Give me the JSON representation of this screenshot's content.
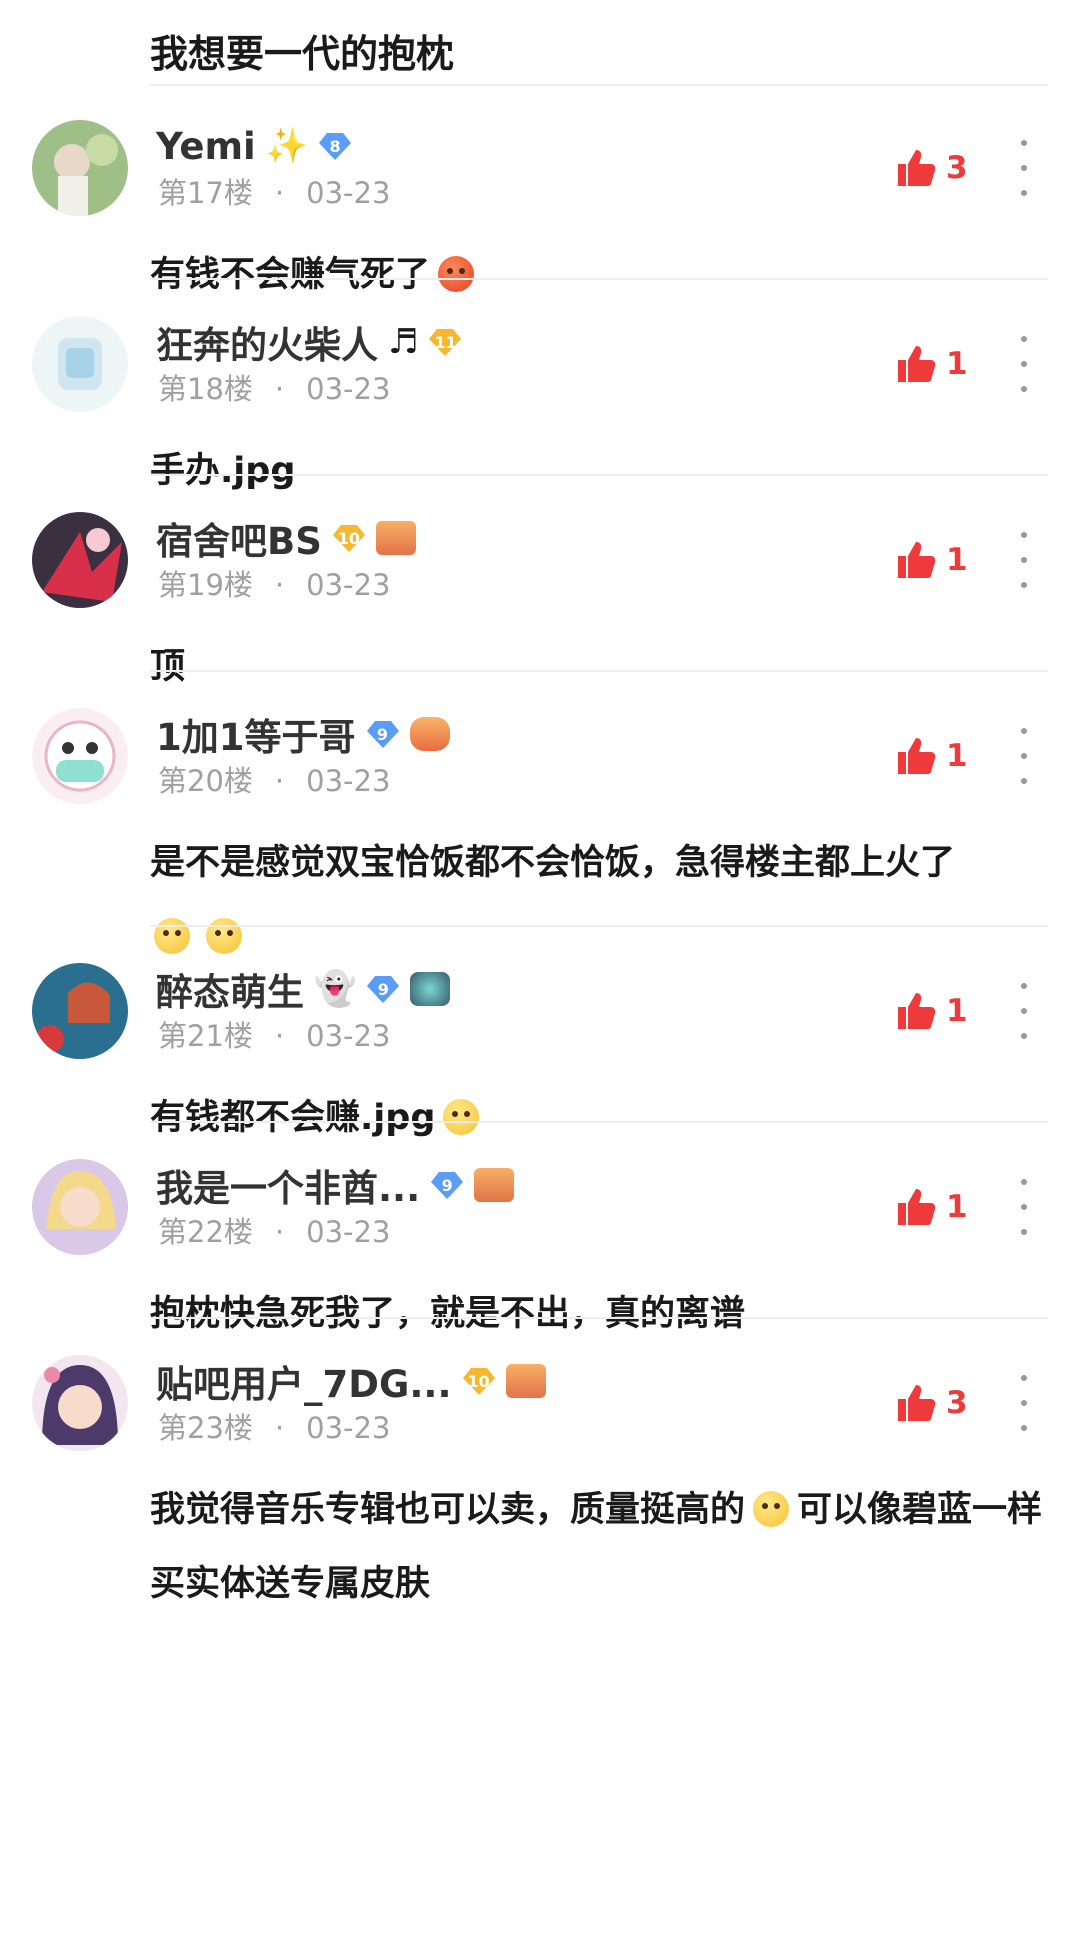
{
  "top_reply": {
    "text": "我想要一代的抱枕"
  },
  "accent": "#ee3a3a",
  "comments": [
    {
      "username": "Yemi",
      "name_emoji": "✨",
      "level": "8",
      "level_color": "#5b9cf6",
      "medal": false,
      "floor": "第17楼",
      "date": "03-23",
      "likes": "3",
      "text": "有钱不会赚气死了",
      "emojis": [
        "red-angry-face-emoji"
      ]
    },
    {
      "username": "狂奔的火柴人",
      "name_emoji": "♬",
      "level": "11",
      "level_color": "#f5b82e",
      "medal": false,
      "floor": "第18楼",
      "date": "03-23",
      "likes": "1",
      "text": "手办.jpg",
      "emojis": []
    },
    {
      "username": "宿舍吧BS",
      "name_emoji": "",
      "level": "10",
      "level_color": "#f5b82e",
      "medal": true,
      "floor": "第19楼",
      "date": "03-23",
      "likes": "1",
      "text": "顶",
      "emojis": []
    },
    {
      "username": "1加1等于哥",
      "name_emoji": "",
      "level": "9",
      "level_color": "#5b9cf6",
      "medal": true,
      "floor": "第20楼",
      "date": "03-23",
      "likes": "1",
      "text": "是不是感觉双宝恰饭都不会恰饭，急得楼主都上火了",
      "emojis": [
        "smile-emoji",
        "smile-emoji"
      ]
    },
    {
      "username": "醉态萌生",
      "name_emoji": "👻",
      "level": "9",
      "level_color": "#5b9cf6",
      "medal": true,
      "floor": "第21楼",
      "date": "03-23",
      "likes": "1",
      "text": "有钱都不会赚.jpg",
      "emojis": [
        "smile-emoji"
      ]
    },
    {
      "username": "我是一个非酋...",
      "name_emoji": "",
      "level": "9",
      "level_color": "#5b9cf6",
      "medal": true,
      "floor": "第22楼",
      "date": "03-23",
      "likes": "1",
      "text": "抱枕快急死我了，就是不出，真的离谱",
      "emojis": []
    },
    {
      "username": "贴吧用户_7DG...",
      "name_emoji": "",
      "level": "10",
      "level_color": "#f5b82e",
      "medal": true,
      "floor": "第23楼",
      "date": "03-23",
      "likes": "3",
      "text_parts": [
        "我觉得音乐专辑也可以卖，质量挺高的",
        "可以像碧蓝一样买实体送专属皮肤"
      ],
      "emojis": [
        "sad-face-emoji"
      ]
    }
  ]
}
